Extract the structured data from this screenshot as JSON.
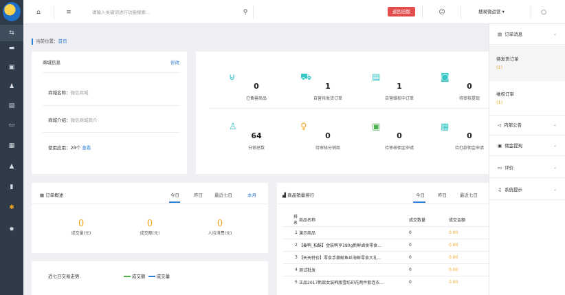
{
  "topbar": {
    "search_placeholder": "请输入关键词进行功能搜索...",
    "return_label": "返回旧版",
    "store_label": "搜易微运营"
  },
  "breadcrumb": {
    "prefix": "当前位置：",
    "current": "首页"
  },
  "shop_info": {
    "title": "商城信息",
    "edit": "修改",
    "rows": [
      {
        "label": "商城名称：",
        "value": "微信商城"
      },
      {
        "label": "商城介绍：",
        "value": "微信商城简介"
      },
      {
        "label": "使用应用：",
        "value": "28个",
        "link": "查看"
      }
    ]
  },
  "stats": [
    {
      "icon": "inventory-icon",
      "num": "0",
      "label": "已售罄商品"
    },
    {
      "icon": "truck-icon",
      "num": "1",
      "label": "自营待发货订单"
    },
    {
      "icon": "document-icon",
      "num": "1",
      "label": "自营维权中订单"
    },
    {
      "icon": "review-icon",
      "num": "0",
      "label": "待审核提现"
    },
    {
      "icon": "users-icon",
      "num": "64",
      "label": "分销总数"
    },
    {
      "icon": "user-icon",
      "num": "0",
      "label": "待审核分销商"
    },
    {
      "icon": "commission-icon",
      "num": "0",
      "label": "待审核佣金申请"
    },
    {
      "icon": "payment-icon",
      "num": "0",
      "label": "待打款佣金申请"
    }
  ],
  "order_overview": {
    "title": "订单概述",
    "tabs": [
      "今日",
      "昨日",
      "最近七日",
      "本月"
    ],
    "metrics": [
      {
        "value": "0",
        "label": "成交量(元)"
      },
      {
        "value": "0",
        "label": "成交额(元)"
      },
      {
        "value": "0",
        "label": "人均消费(元)"
      }
    ]
  },
  "trend": {
    "title": "近七日交易走势",
    "legend": [
      "成交额",
      "成交量"
    ]
  },
  "sales_rank": {
    "title": "商品销量排行",
    "tabs": [
      "今日",
      "昨日",
      "最近七日"
    ],
    "headers": [
      "排名",
      "商品名称",
      "成交数量",
      "成交金额"
    ],
    "rows": [
      [
        "1",
        "演示商品",
        "0",
        "0.00"
      ],
      [
        "2",
        "【秦鸭_柏酥】金装鸭亨180g新鲜卤食零食...",
        "0",
        "0.00"
      ],
      [
        "3",
        "【天天特价】零食手撕鱿鱼丝海鲜零食大礼...",
        "0",
        "0.00"
      ],
      [
        "4",
        "测试批发",
        "0",
        "0.00"
      ],
      [
        "5",
        "正品2017新款女装韩版雪纺印花两件套连衣...",
        "0",
        "0.00"
      ]
    ]
  },
  "right_panel": {
    "orders": "订单消息",
    "pending_ship": "待发货订单",
    "pending_ship_count": "(1)",
    "rights": "维权订单",
    "rights_count": "(1)",
    "notice": "内部公告",
    "withdraw": "佣金提现",
    "review": "评价",
    "system": "系统提示"
  },
  "colors": {
    "accent": "#2f7fd6",
    "orange": "#f5a623",
    "sidebar": "#2f3b49",
    "red": "#e44d4d"
  }
}
